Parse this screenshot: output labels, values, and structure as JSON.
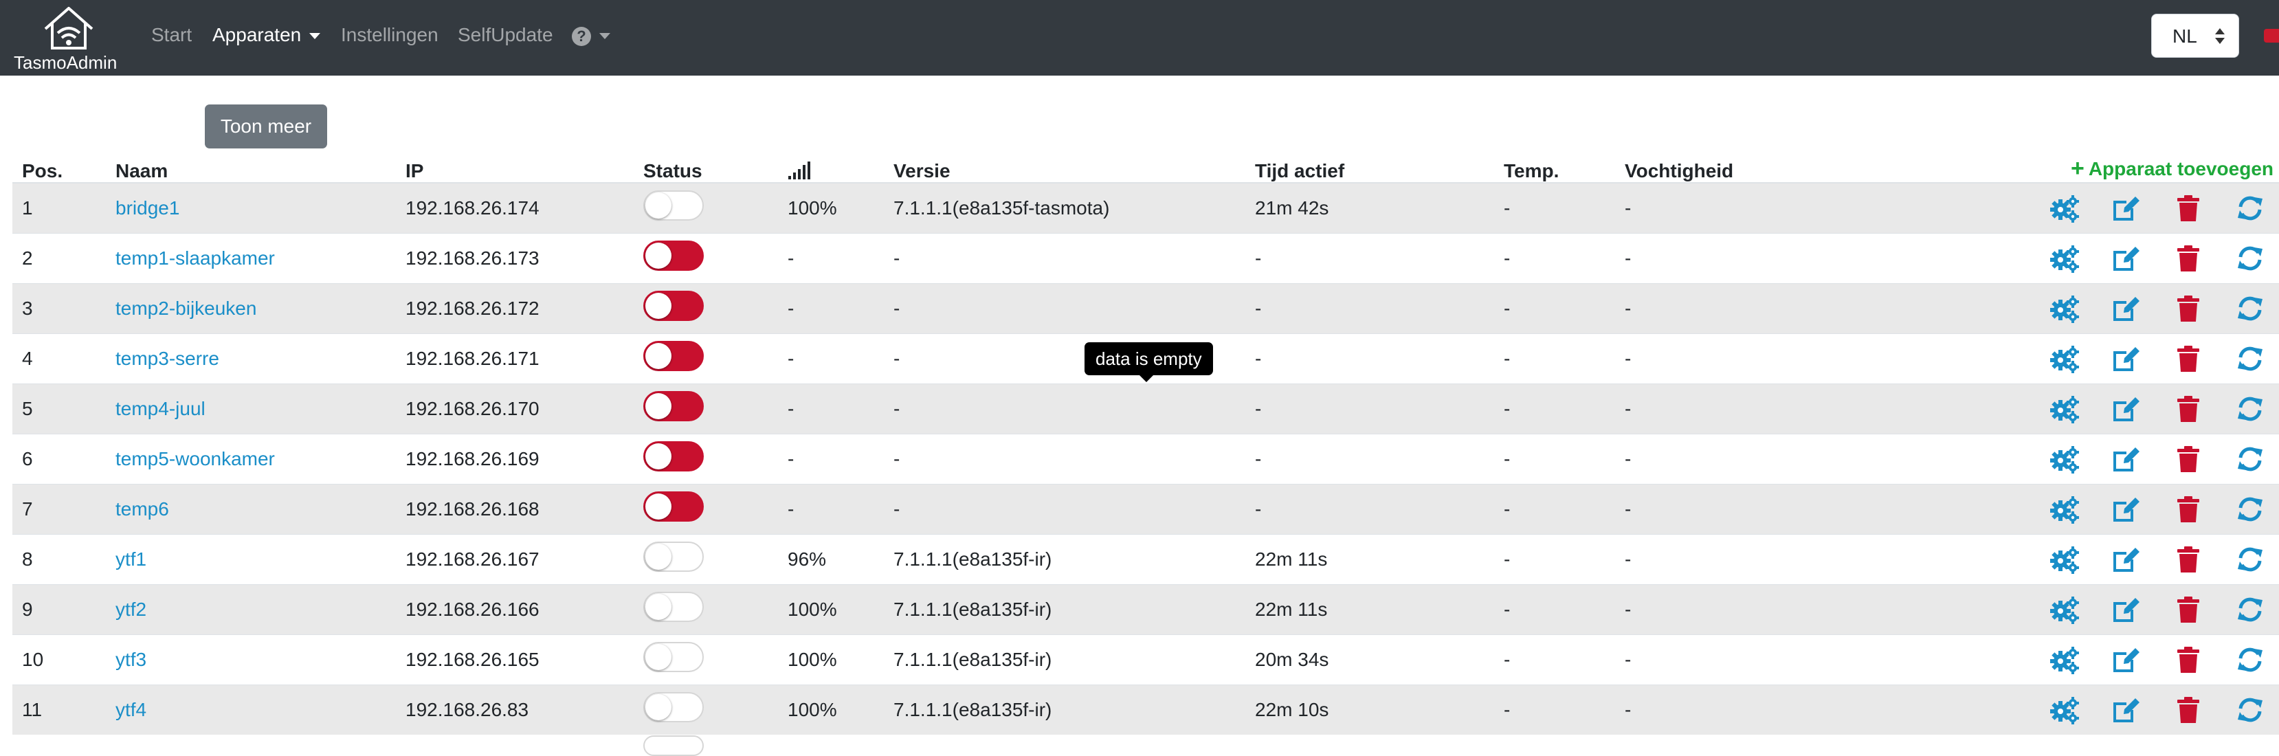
{
  "app": {
    "brand": "TasmoAdmin"
  },
  "nav": {
    "items": [
      {
        "label": "Start"
      },
      {
        "label": "Apparaten"
      },
      {
        "label": "Instellingen"
      },
      {
        "label": "SelfUpdate"
      }
    ],
    "help_icon": "question-circle-icon",
    "language": "NL"
  },
  "toolbar": {
    "show_more_label": "Toon meer"
  },
  "table": {
    "headers": {
      "pos": "Pos.",
      "name": "Naam",
      "ip": "IP",
      "status": "Status",
      "signal_icon": "wifi-signal-icon",
      "version": "Versie",
      "uptime": "Tijd actief",
      "temp": "Temp.",
      "humidity": "Vochtigheid",
      "add": "Apparaat toevoegen"
    },
    "rows": [
      {
        "pos": "1",
        "name": "bridge1",
        "ip": "192.168.26.174",
        "status": "off",
        "signal": "100%",
        "version": "7.1.1.1(e8a135f-tasmota)",
        "uptime": "21m 42s",
        "temp": "-",
        "humidity": "-"
      },
      {
        "pos": "2",
        "name": "temp1-slaapkamer",
        "ip": "192.168.26.173",
        "status": "on",
        "signal": "-",
        "version": "-",
        "uptime": "-",
        "temp": "-",
        "humidity": "-"
      },
      {
        "pos": "3",
        "name": "temp2-bijkeuken",
        "ip": "192.168.26.172",
        "status": "on",
        "signal": "-",
        "version": "-",
        "uptime": "-",
        "temp": "-",
        "humidity": "-"
      },
      {
        "pos": "4",
        "name": "temp3-serre",
        "ip": "192.168.26.171",
        "status": "on",
        "signal": "-",
        "version": "-",
        "uptime": "-",
        "temp": "-",
        "humidity": "-"
      },
      {
        "pos": "5",
        "name": "temp4-juul",
        "ip": "192.168.26.170",
        "status": "on",
        "signal": "-",
        "version": "-",
        "uptime": "-",
        "temp": "-",
        "humidity": "-"
      },
      {
        "pos": "6",
        "name": "temp5-woonkamer",
        "ip": "192.168.26.169",
        "status": "on",
        "signal": "-",
        "version": "-",
        "uptime": "-",
        "temp": "-",
        "humidity": "-"
      },
      {
        "pos": "7",
        "name": "temp6",
        "ip": "192.168.26.168",
        "status": "on",
        "signal": "-",
        "version": "-",
        "uptime": "-",
        "temp": "-",
        "humidity": "-"
      },
      {
        "pos": "8",
        "name": "ytf1",
        "ip": "192.168.26.167",
        "status": "off",
        "signal": "96%",
        "version": "7.1.1.1(e8a135f-ir)",
        "uptime": "22m 11s",
        "temp": "-",
        "humidity": "-"
      },
      {
        "pos": "9",
        "name": "ytf2",
        "ip": "192.168.26.166",
        "status": "off",
        "signal": "100%",
        "version": "7.1.1.1(e8a135f-ir)",
        "uptime": "22m 11s",
        "temp": "-",
        "humidity": "-"
      },
      {
        "pos": "10",
        "name": "ytf3",
        "ip": "192.168.26.165",
        "status": "off",
        "signal": "100%",
        "version": "7.1.1.1(e8a135f-ir)",
        "uptime": "20m 34s",
        "temp": "-",
        "humidity": "-"
      },
      {
        "pos": "11",
        "name": "ytf4",
        "ip": "192.168.26.83",
        "status": "off",
        "signal": "100%",
        "version": "7.1.1.1(e8a135f-ir)",
        "uptime": "22m 10s",
        "temp": "-",
        "humidity": "-"
      }
    ],
    "action_icons": [
      "gears-icon",
      "edit-icon",
      "trash-icon",
      "refresh-icon"
    ]
  },
  "tooltip": {
    "text": "data is empty"
  },
  "colors": {
    "navbar": "#343a40",
    "link": "#1a8ec8",
    "add_green": "#1ea83a",
    "toggle_on": "#c8102e",
    "delete_red": "#c8102e",
    "row_stripe": "#e9e9e9",
    "button_gray": "#6c757d"
  }
}
